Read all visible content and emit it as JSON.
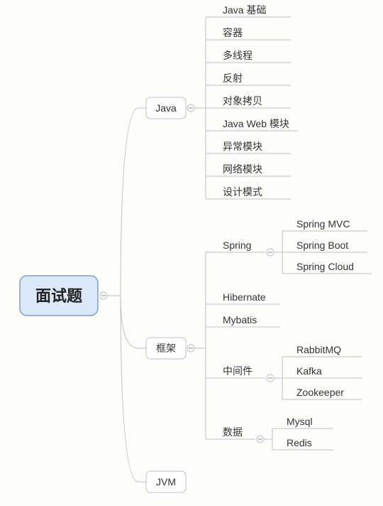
{
  "root": {
    "label": "面试题"
  },
  "branches": {
    "java": {
      "label": "Java",
      "children": [
        "Java 基础",
        "容器",
        "多线程",
        "反射",
        "对象拷贝",
        "Java Web 模块",
        "异常模块",
        "网络模块",
        "设计模式"
      ]
    },
    "framework": {
      "label": "框架",
      "spring": {
        "label": "Spring",
        "children": [
          "Spring MVC",
          "Spring Boot",
          "Spring Cloud"
        ]
      },
      "hibernate": "Hibernate",
      "mybatis": "Mybatis",
      "middleware": {
        "label": "中间件",
        "children": [
          "RabbitMQ",
          "Kafka",
          "Zookeeper"
        ]
      },
      "data": {
        "label": "数据",
        "children": [
          "Mysql",
          "Redis"
        ]
      }
    },
    "jvm": {
      "label": "JVM"
    }
  }
}
